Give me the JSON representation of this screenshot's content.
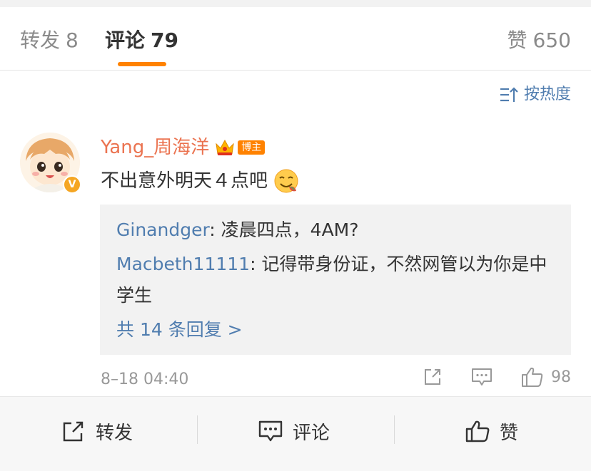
{
  "tabs": {
    "repost": {
      "label": "转发",
      "count": "8"
    },
    "comment": {
      "label": "评论",
      "count": "79"
    },
    "like": {
      "label": "赞",
      "count": "650"
    }
  },
  "sort": {
    "label": "按热度",
    "icon": "sort-icon"
  },
  "comment": {
    "username": "Yang_周海洋",
    "owner_badge": "博主",
    "verified_badge": "V",
    "text": "不出意外明天４点吧",
    "time": "8–18 04:40",
    "like_count": "98",
    "replies": [
      {
        "name": "Ginandger",
        "text": ": 凌晨四点，4AM?"
      },
      {
        "name": "Macbeth11111",
        "text": ": 记得带身份证，不然网管以为你是中学生"
      }
    ],
    "more_replies": "共 14 条回复 >"
  },
  "bottom_bar": {
    "repost": "转发",
    "comment": "评论",
    "like": "赞"
  },
  "colors": {
    "accent": "#ff8200",
    "username": "#eb7350",
    "link": "#507daf",
    "muted": "#999999"
  }
}
